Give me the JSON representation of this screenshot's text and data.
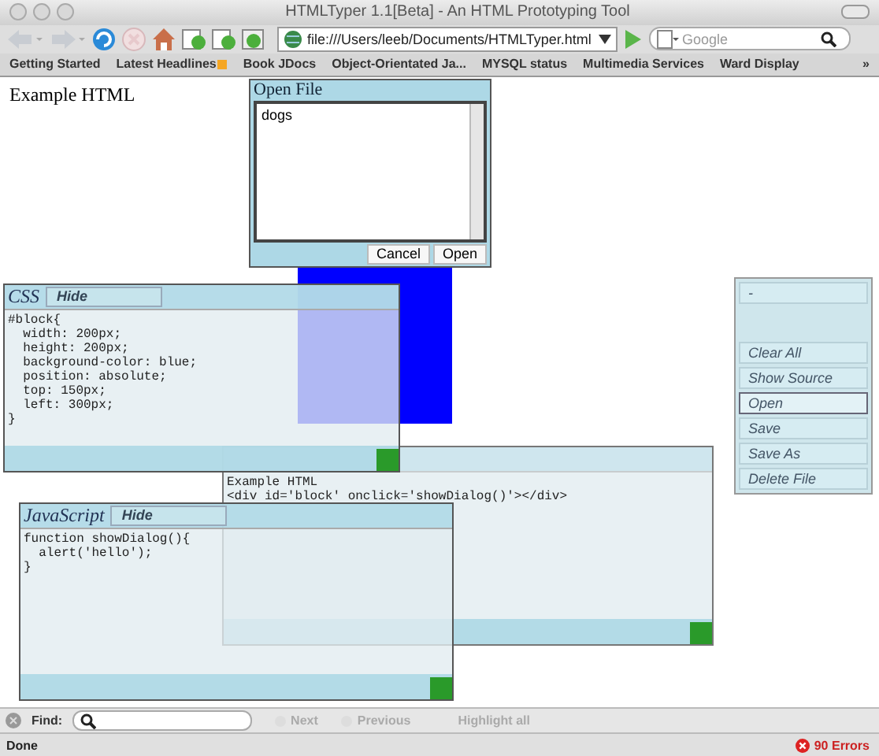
{
  "window": {
    "title": "HTMLTyper 1.1[Beta] - An HTML Prototyping Tool"
  },
  "toolbar": {
    "url": "file:///Users/leeb/Documents/HTMLTyper.html",
    "search_placeholder": "Google"
  },
  "bookmarks": [
    {
      "label": "Getting Started",
      "kind": "plain"
    },
    {
      "label": "Latest Headlines",
      "kind": "feed"
    },
    {
      "label": "Book JDocs",
      "kind": "plain"
    },
    {
      "label": "Object-Orientated Ja...",
      "kind": "plain"
    },
    {
      "label": "MYSQL status",
      "kind": "plain"
    },
    {
      "label": "Multimedia Services",
      "kind": "plain"
    },
    {
      "label": "Ward Display",
      "kind": "plain"
    }
  ],
  "bookmarks_more": "»",
  "page": {
    "heading": "Example HTML",
    "dialog": {
      "title": "Open File",
      "files": [
        {
          "name": "dogs",
          "selected": false
        }
      ],
      "buttons": [
        "Cancel",
        "Open"
      ]
    },
    "panels": [
      {
        "kind": "css",
        "title": "CSS",
        "hide": "Hide",
        "lines": [
          "#block{",
          "  width: 200px;",
          "  height: 200px;",
          "  background-color: blue;",
          "  position: absolute;",
          "  top: 150px;",
          "  left: 300px;",
          "}"
        ]
      },
      {
        "kind": "html",
        "lines": [
          "Example HTML",
          "<div id='block' onclick='showDialog()'></div>"
        ]
      },
      {
        "kind": "js",
        "title": "JavaScript",
        "hide": "Hide",
        "lines": [
          "function showDialog(){",
          "  alert('hello');",
          "}"
        ]
      }
    ],
    "side_buttons": [
      {
        "label": "-",
        "selected": false
      },
      {
        "label": "Clear All",
        "selected": false
      },
      {
        "label": "Show Source",
        "selected": false
      },
      {
        "label": "Open",
        "selected": true
      },
      {
        "label": "Save",
        "selected": false
      },
      {
        "label": "Save As",
        "selected": false
      },
      {
        "label": "Delete File",
        "selected": false
      }
    ]
  },
  "find_bar": {
    "label": "Find:",
    "next": "Next",
    "previous": "Previous",
    "highlight": "Highlight all"
  },
  "status_bar": {
    "text": "Done",
    "errors": "90 Errors"
  }
}
